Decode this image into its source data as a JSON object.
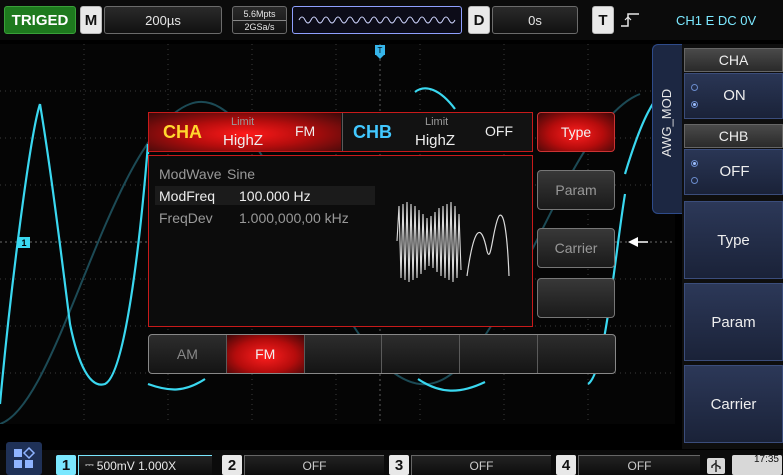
{
  "topbar": {
    "status": "TRIGED",
    "mode_letter": "M",
    "timebase": "200µs",
    "memory_depth": "5.6Mpts",
    "sample_rate": "2GSa/s",
    "delay_letter": "D",
    "delay_value": "0s",
    "trigger_letter": "T",
    "trigger_info": "CH1 E DC 0V"
  },
  "awg_dialog": {
    "cha": {
      "name": "CHA",
      "limit": "Limit",
      "impedance": "HighZ",
      "state": "FM"
    },
    "chb": {
      "name": "CHB",
      "limit": "Limit",
      "impedance": "HighZ",
      "state": "OFF"
    },
    "params": [
      {
        "label": "ModWave",
        "value": "Sine"
      },
      {
        "label": "ModFreq",
        "value": "100.000 Hz"
      },
      {
        "label": "FreqDev",
        "value": "1.000,000,00 kHz"
      }
    ],
    "side_buttons": {
      "type": "Type",
      "param": "Param",
      "carrier": "Carrier",
      "blank": ""
    },
    "tabs": [
      "AM",
      "FM",
      "",
      "",
      "",
      ""
    ],
    "active_tab": "FM"
  },
  "right_menu": {
    "panel_label": "AWG_MOD",
    "cha_header": "CHA",
    "cha_value": "ON",
    "chb_header": "CHB",
    "chb_value": "OFF",
    "type_label": "Type",
    "param_label": "Param",
    "carrier_label": "Carrier"
  },
  "bottombar": {
    "ch1_num": "1",
    "ch1_info": "500mV 1.000X",
    "ch2_num": "2",
    "ch2_info": "OFF",
    "ch3_num": "3",
    "ch3_info": "OFF",
    "ch4_num": "4",
    "ch4_info": "OFF",
    "time": "17:35"
  },
  "markers": {
    "ch1_ground": "1",
    "trigger_pos": "T"
  },
  "colors": {
    "ch1": "#3ad8f0",
    "accent_red": "#d01515",
    "menu_blue": "#243150",
    "triged_green": "#1e7a1e"
  }
}
